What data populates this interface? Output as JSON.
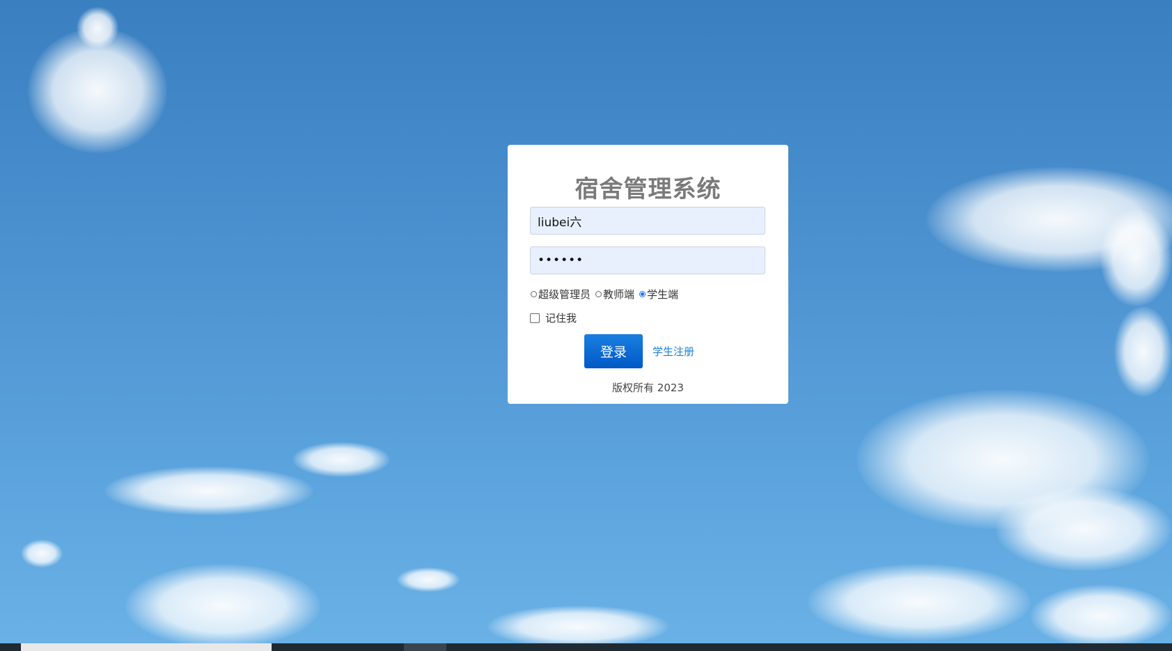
{
  "login": {
    "title": "宿舍管理系统",
    "username_value": "liubei六",
    "password_value": "••••••",
    "roles": [
      {
        "label": "超级管理员",
        "checked": false
      },
      {
        "label": "教师端",
        "checked": false
      },
      {
        "label": "学生端",
        "checked": true
      }
    ],
    "remember_label": "记住我",
    "login_button": "登录",
    "register_link": "学生注册",
    "copyright": "版权所有 2023"
  },
  "colors": {
    "accent": "#0059c6",
    "link": "#1a7fd8",
    "title": "#7a7a7a",
    "input_bg": "#e8f0fe"
  }
}
